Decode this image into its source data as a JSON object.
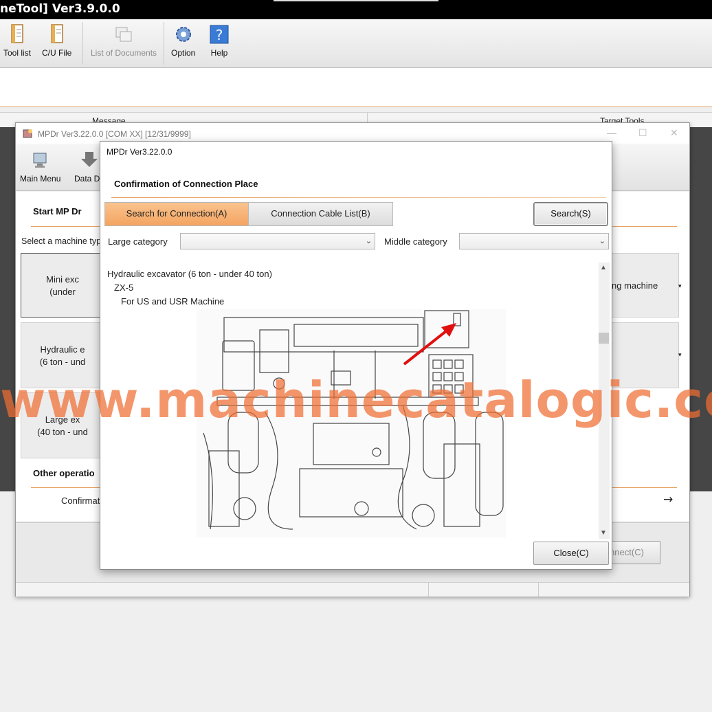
{
  "app": {
    "title": "neTool] Ver3.9.0.0",
    "toolbar": [
      {
        "label": "Tool list",
        "icon": "document-icon",
        "enabled": true
      },
      {
        "label": "C/U File",
        "icon": "file-icon",
        "enabled": true
      },
      {
        "label": "List of Documents",
        "icon": "documents-icon",
        "enabled": false
      },
      {
        "label": "Option",
        "icon": "gear-icon",
        "enabled": true
      },
      {
        "label": "Help",
        "icon": "help-icon",
        "enabled": true
      }
    ],
    "columns": {
      "message": "Message",
      "target_tools": "Target Tools"
    }
  },
  "mpdr": {
    "title": "MPDr Ver3.22.0.0 [COM XX] [12/31/9999]",
    "toolbar": {
      "main_menu": "Main Menu",
      "data": "Data Do"
    },
    "start_title": "Start MP Dr",
    "select_label": "Select a machine typ",
    "cards": [
      {
        "line1": "Mini exc",
        "line2": "(under"
      },
      {
        "line1": "Hydraulic e",
        "line2": "(6 ton - und"
      },
      {
        "line1": "Large ex",
        "line2": "(40 ton - und"
      }
    ],
    "right_card": "ng machine",
    "other_title": "Other operatio",
    "confirm_text": "Confirmat",
    "arrow": "→",
    "connect_button": "nnect(C)"
  },
  "dialog": {
    "title": "MPDr Ver3.22.0.0",
    "heading": "Confirmation of Connection Place",
    "tabs": [
      {
        "label": "Search for Connection(A)",
        "active": true
      },
      {
        "label": "Connection Cable List(B)",
        "active": false
      }
    ],
    "search_button": "Search(S)",
    "large_category_label": "Large category",
    "large_category_value": "",
    "middle_category_label": "Middle category",
    "middle_category_value": "",
    "tree": {
      "level1": "Hydraulic excavator (6 ton - under 40 ton)",
      "level2": "ZX-5",
      "level3": "For US and USR Machine"
    },
    "close_button": "Close(C)"
  },
  "watermark": "www.machinecatalogic.com",
  "colors": {
    "accent": "#f4a460",
    "watermark": "#f06e32",
    "dark_band": "#464646"
  }
}
